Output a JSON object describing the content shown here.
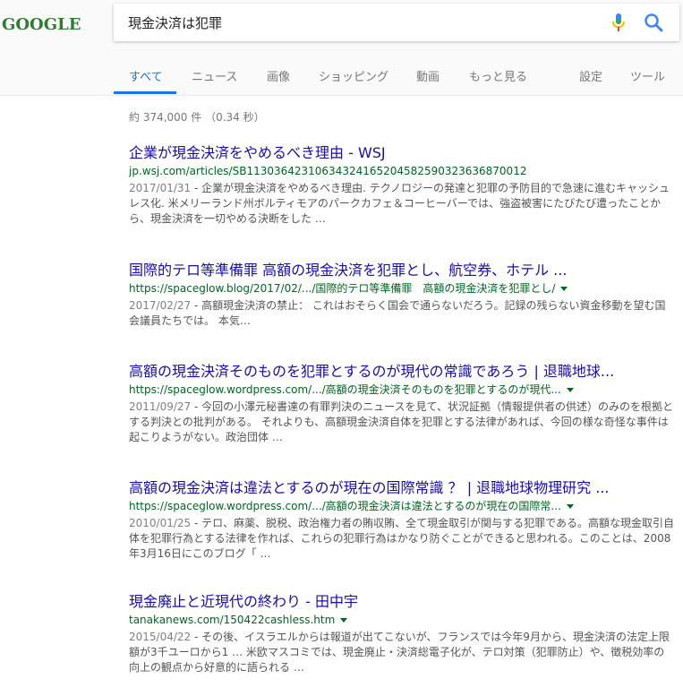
{
  "logo": "GOOGLE",
  "search": {
    "query": "現金決済は犯罪"
  },
  "tabs": [
    "すべて",
    "ニュース",
    "画像",
    "ショッピング",
    "動画",
    "もっと見る",
    "設定",
    "ツール"
  ],
  "stats": "約 374,000 件 （0.34 秒）",
  "results": [
    {
      "title": "企業が現金決済をやめるべき理由 - WSJ",
      "url": "jp.wsj.com/articles/SB11303642310634324165204582590323636870012",
      "date": "2017/01/31",
      "snippet": "企業が現金決済をやめるべき理由. テクノロジーの発達と犯罪の予防目的で急速に進むキャッシュレス化. 米メリーランド州ボルティモアのパークカフェ＆コーヒーバーでは、強盗被害にたびたび遭ったことから、現金決済を一切やめる決断をした …"
    },
    {
      "title": "国際的テロ等準備罪 高額の現金決済を犯罪とし、航空券、ホテル ...",
      "url": "https://spaceglow.blog/2017/02/.../国際的テロ等準備罪　高額の現金決済を犯罪とし/",
      "date": "2017/02/27",
      "snippet": "高額現金決済の禁止： これはおそらく国会で通らないだろう。記録の残らない資金移動を望む国会議員たちでは。 本気…"
    },
    {
      "title": "高額の現金決済そのものを犯罪とするのが現代の常識であろう | 退職地球...",
      "url": "https://spaceglow.wordpress.com/.../高額の現金決済そのものを犯罪とするのが現代...",
      "date": "2011/09/27",
      "snippet": "今回の小澤元秘書達の有罪判決のニュースを見て、状況証拠（情報提供者の供述）のみのを根拠とする判決との批判がある。 それよりも、高額現金決済自体を犯罪とする法律があれば、今回の様な奇怪な事件は起こりようがない。政治団体 …"
    },
    {
      "title": "高額の現金決済は違法とするのが現在の国際常識 ？ | 退職地球物理研究 ...",
      "url": "https://spaceglow.wordpress.com/.../高額の現金決済は違法とするのが現在の国際常...",
      "date": "2010/01/25",
      "snippet": "テロ、麻薬、脱税、政治権力者の賄収賄、全て現金取引が関与する犯罪である。高額な現金取引自体を犯罪行為とする法律を作れば、これらの犯罪行為はかなり防ぐことができると思われる。このことは、2008年3月16日にこのブログ「 …"
    },
    {
      "title": "現金廃止と近現代の終わり - 田中宇",
      "url": "tanakanews.com/150422cashless.htm",
      "date": "2015/04/22",
      "snippet": "その後、イスラエルからは報道が出てこないが、フランスでは今年9月から、現金決済の法定上限額が3千ユーロから1 … 米欧マスコミでは、現金廃止・決済総電子化が、テロ対策（犯罪防止）や、徴税効率の向上の観点から好意的に語られる …"
    }
  ],
  "colors": {
    "link": "#1a0dab",
    "url": "#006621",
    "accent": "#1a73e8"
  },
  "icons": [
    "microphone-icon",
    "search-icon",
    "dropdown-arrow-icon"
  ]
}
